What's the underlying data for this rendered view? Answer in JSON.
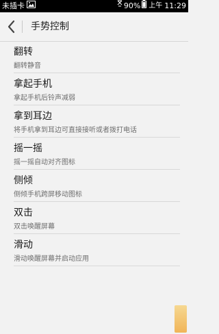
{
  "status_bar": {
    "carrier": "未插卡",
    "battery_percent": "90%",
    "ampm": "上午",
    "time": "11:29",
    "icons": [
      "picture-icon",
      "signal-off-icon",
      "battery-icon"
    ]
  },
  "header": {
    "title": "手势控制",
    "back_icon": "chevron-left-icon"
  },
  "items": [
    {
      "title": "翻转",
      "subtitle": "翻转静音"
    },
    {
      "title": "拿起手机",
      "subtitle": "拿起手机后铃声减弱"
    },
    {
      "title": "拿到耳边",
      "subtitle": "将手机拿到耳边可直接接听或者拨打电话"
    },
    {
      "title": "摇一摇",
      "subtitle": "摇一摇自动对齐图标"
    },
    {
      "title": "侧倾",
      "subtitle": "侧倾手机跨屏移动图标"
    },
    {
      "title": "双击",
      "subtitle": "双击唤醒屏幕"
    },
    {
      "title": "滑动",
      "subtitle": "滑动唤醒屏幕并启动应用"
    }
  ],
  "colors": {
    "background": "#f2f2f2",
    "status_bar": "#000000",
    "divider": "#d8d8d8"
  }
}
